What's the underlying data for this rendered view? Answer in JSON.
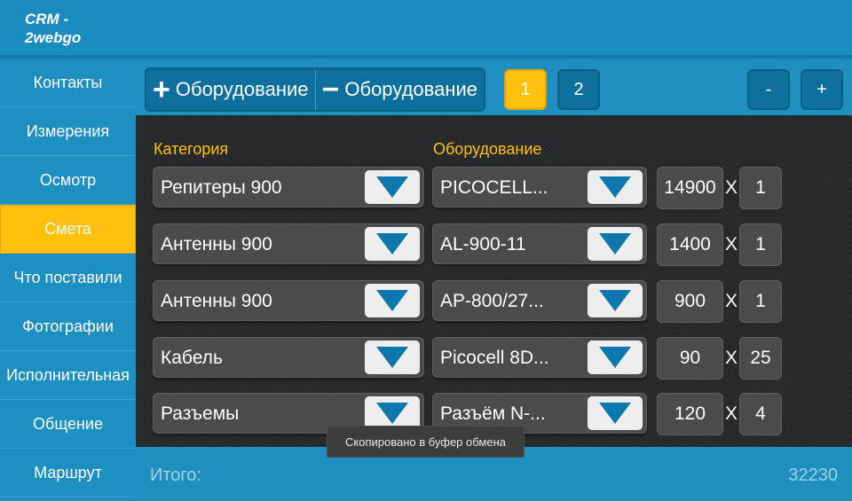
{
  "app": {
    "title": "CRM -\n2webgo"
  },
  "sidebar": {
    "items": [
      {
        "label": "Контакты"
      },
      {
        "label": "Измерения"
      },
      {
        "label": "Осмотр"
      },
      {
        "label": "Смета",
        "active": true
      },
      {
        "label": "Что поставили"
      },
      {
        "label": "Фотографии"
      },
      {
        "label": "Исполнительная"
      },
      {
        "label": "Общение"
      },
      {
        "label": "Маршрут"
      }
    ]
  },
  "toolbar": {
    "add_symbol": "+",
    "add_label": "Оборудование",
    "remove_symbol": "−",
    "remove_label": "Оборудование",
    "pages": [
      "1",
      "2"
    ],
    "active_page": "1",
    "minus_label": "-",
    "plus_label": "+"
  },
  "table": {
    "category_header": "Категория",
    "equipment_header": "Оборудование",
    "multiply_sign": "X",
    "rows": [
      {
        "category": "Репитеры 900",
        "equipment": "PICOCELL...",
        "price": "14900",
        "qty": "1"
      },
      {
        "category": "Антенны 900",
        "equipment": "AL-900-11",
        "price": "1400",
        "qty": "1"
      },
      {
        "category": "Антенны 900",
        "equipment": "AP-800/27...",
        "price": "900",
        "qty": "1"
      },
      {
        "category": "Кабель",
        "equipment": "Picocell 8D...",
        "price": "90",
        "qty": "25"
      },
      {
        "category": "Разъемы",
        "equipment": "Разъём N-...",
        "price": "120",
        "qty": "4"
      }
    ]
  },
  "toast": {
    "text": "Скопировано в буфер обмена"
  },
  "footer": {
    "total_label": "Итого:",
    "total_value": "32230"
  },
  "colors": {
    "accent": "#ffc10e",
    "primary": "#1f8fbf",
    "dark_bg": "#262829",
    "arrow": "#0d78ad"
  }
}
